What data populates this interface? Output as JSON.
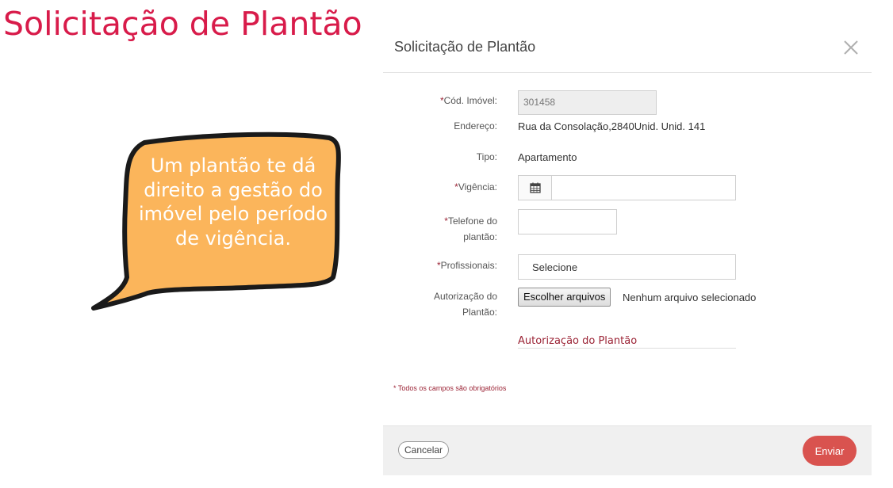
{
  "page": {
    "title": "Solicitação de Plantão",
    "speech_bubble": "Um plantão te dá direito a gestão do imóvel pelo período de vigência."
  },
  "modal": {
    "title": "Solicitação de Plantão",
    "close_icon": "close-icon",
    "fields": {
      "cod_imovel": {
        "label": "Cód. Imóvel:",
        "required": "*",
        "value": "301458"
      },
      "endereco": {
        "label": "Endereço:",
        "value": "Rua da Consolação,2840Unid. Unid. 141"
      },
      "tipo": {
        "label": "Tipo:",
        "value": "Apartamento"
      },
      "vigencia": {
        "label": "Vigência:",
        "required": "*",
        "value": "",
        "icon": "calendar-icon"
      },
      "telefone": {
        "label_line1": "Telefone do",
        "label_line2": "plantão:",
        "required": "*",
        "value": ""
      },
      "profissionais": {
        "label": "Profissionais:",
        "required": "*",
        "selected": "Selecione"
      },
      "autorizacao": {
        "label_line1": "Autorização do",
        "label_line2": "Plantão:",
        "button": "Escolher arquivos",
        "status": "Nenhum arquivo selecionado",
        "link": "Autorização do Plantão"
      }
    },
    "required_note": "* Todos os campos são obrigatórios",
    "footer": {
      "cancel": "Cancelar",
      "send": "Enviar"
    }
  },
  "colors": {
    "title": "#d81b4a",
    "bubble": "#fbb55b",
    "accent": "#9b2335",
    "send_button": "#d9534f"
  }
}
